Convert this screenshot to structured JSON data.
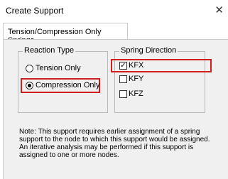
{
  "window": {
    "title": "Create Support",
    "close_symbol": "✕"
  },
  "tab": {
    "label": "Tension/Compression Only Springs."
  },
  "reaction_type": {
    "legend": "Reaction Type",
    "options": [
      {
        "label": "Tension Only",
        "selected": false
      },
      {
        "label": "Compression Only",
        "selected": true
      }
    ]
  },
  "spring_direction": {
    "legend": "Spring Direction",
    "options": [
      {
        "label": "KFX",
        "checked": true
      },
      {
        "label": "KFY",
        "checked": false
      },
      {
        "label": "KFZ",
        "checked": false
      }
    ]
  },
  "note": {
    "line1": "Note: This support requires earlier assignment of a spring",
    "line2": "support to the node to which this support would be assigned.",
    "line3": "An iterative analysis may be performed if this support is",
    "line4": "assigned to one or more nodes."
  },
  "colors": {
    "highlight": "#d11f1f",
    "panel_bg": "#f0f0f0"
  },
  "icons": {
    "close": "close-icon",
    "check": "check-mark-icon",
    "radio": "radio-dot-icon"
  }
}
